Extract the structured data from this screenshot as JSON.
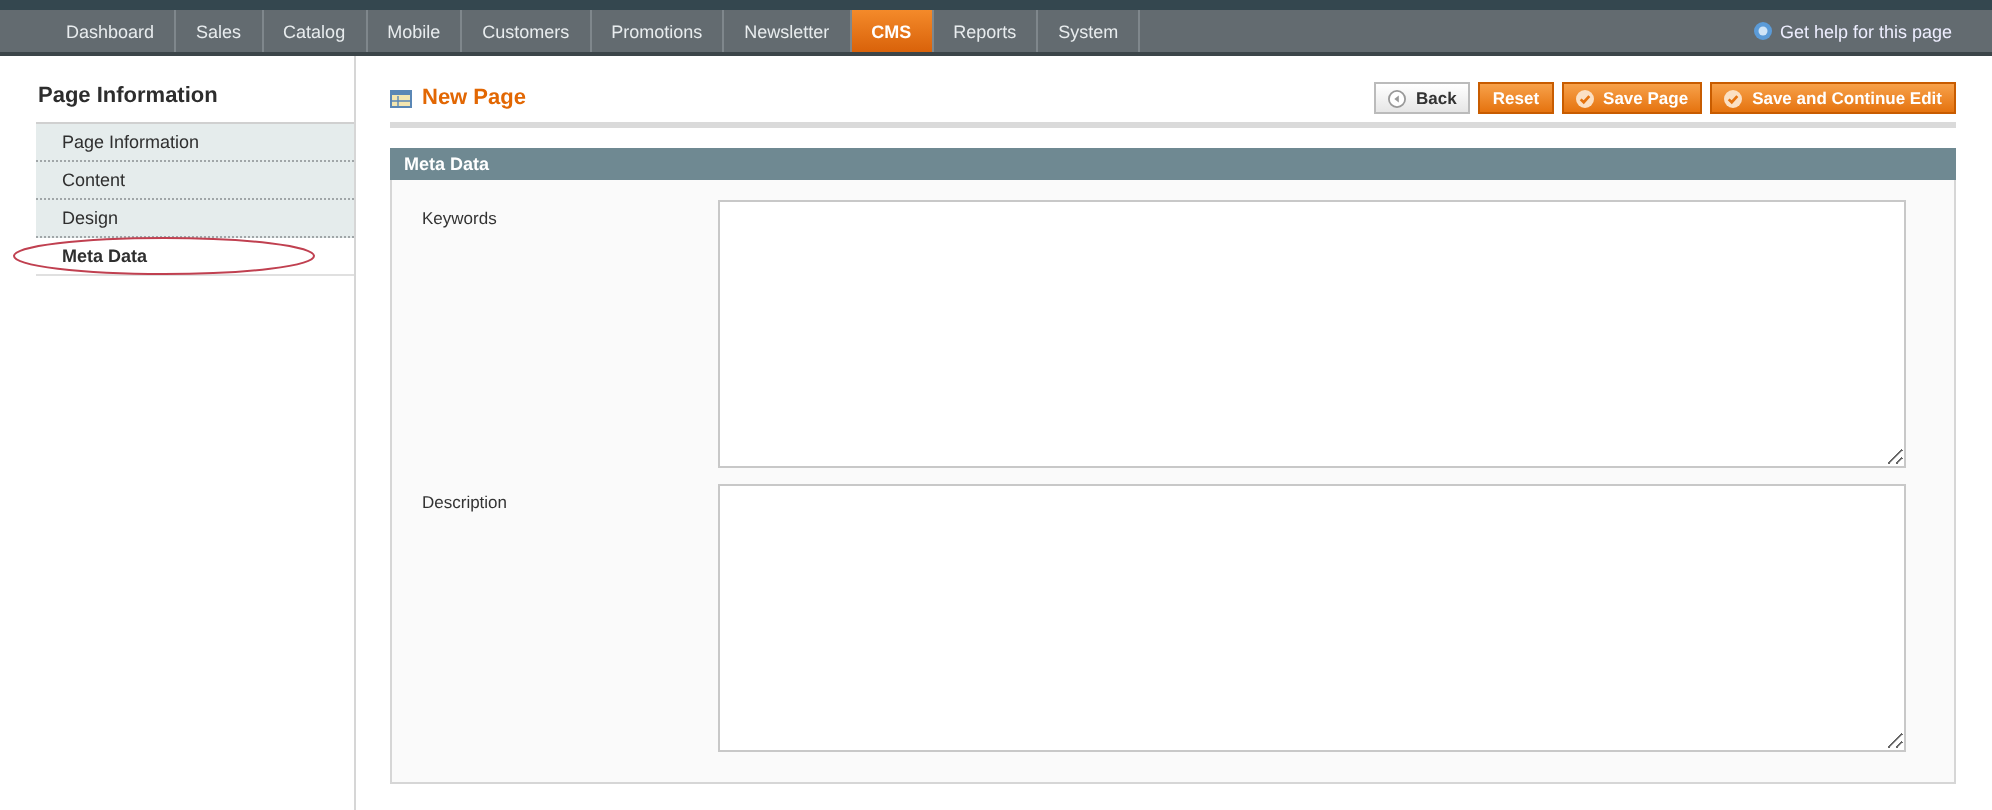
{
  "nav": {
    "items": [
      {
        "label": "Dashboard",
        "selected": false
      },
      {
        "label": "Sales",
        "selected": false
      },
      {
        "label": "Catalog",
        "selected": false
      },
      {
        "label": "Mobile",
        "selected": false
      },
      {
        "label": "Customers",
        "selected": false
      },
      {
        "label": "Promotions",
        "selected": false
      },
      {
        "label": "Newsletter",
        "selected": false
      },
      {
        "label": "CMS",
        "selected": true
      },
      {
        "label": "Reports",
        "selected": false
      },
      {
        "label": "System",
        "selected": false
      }
    ],
    "help": "Get help for this page"
  },
  "sidebar": {
    "title": "Page Information",
    "items": [
      {
        "label": "Page Information",
        "selected": false,
        "circled": false
      },
      {
        "label": "Content",
        "selected": false,
        "circled": false
      },
      {
        "label": "Design",
        "selected": false,
        "circled": false
      },
      {
        "label": "Meta Data",
        "selected": true,
        "circled": true
      }
    ]
  },
  "page": {
    "title": "New Page",
    "buttons": [
      {
        "label": "Back",
        "kind": "back"
      },
      {
        "label": "Reset",
        "kind": "plain"
      },
      {
        "label": "Save Page",
        "kind": "save"
      },
      {
        "label": "Save and Continue Edit",
        "kind": "save"
      }
    ]
  },
  "section": {
    "title": "Meta Data",
    "fields": [
      {
        "label": "Keywords"
      },
      {
        "label": "Description"
      }
    ]
  }
}
